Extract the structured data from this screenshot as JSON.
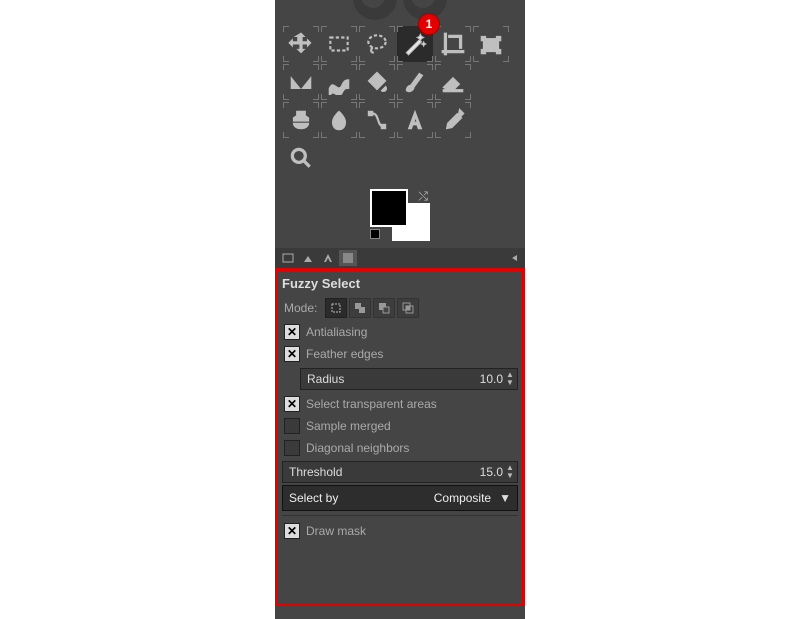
{
  "callouts": {
    "one": "1"
  },
  "toolbox": {
    "tools": [
      "move-tool",
      "rectangle-select-tool",
      "free-select-tool",
      "fuzzy-select-tool",
      "crop-tool",
      "rotate-tool",
      "flip-tool",
      "warp-tool",
      "bucket-fill-tool",
      "paintbrush-tool",
      "eraser-tool",
      "clone-tool",
      "smudge-tool",
      "paths-tool",
      "text-tool",
      "color-picker-tool",
      "zoom-tool"
    ],
    "selected": "fuzzy-select-tool"
  },
  "colors": {
    "fg": "#000000",
    "bg": "#ffffff"
  },
  "tabs": [
    "tool-options-tab",
    "device-status-tab",
    "history-tab",
    "images-tab"
  ],
  "options": {
    "title": "Fuzzy Select",
    "mode_label": "Mode:",
    "antialiasing": {
      "label": "Antialiasing",
      "checked": true
    },
    "feather": {
      "label": "Feather edges",
      "checked": true
    },
    "radius": {
      "label": "Radius",
      "value": "10.0"
    },
    "transparent": {
      "label": "Select transparent areas",
      "checked": true
    },
    "sample_merged": {
      "label": "Sample merged",
      "checked": false
    },
    "diag": {
      "label": "Diagonal neighbors",
      "checked": false
    },
    "threshold": {
      "label": "Threshold",
      "value": "15.0"
    },
    "select_by": {
      "label": "Select by",
      "value": "Composite"
    },
    "draw_mask": {
      "label": "Draw mask",
      "checked": true
    }
  }
}
